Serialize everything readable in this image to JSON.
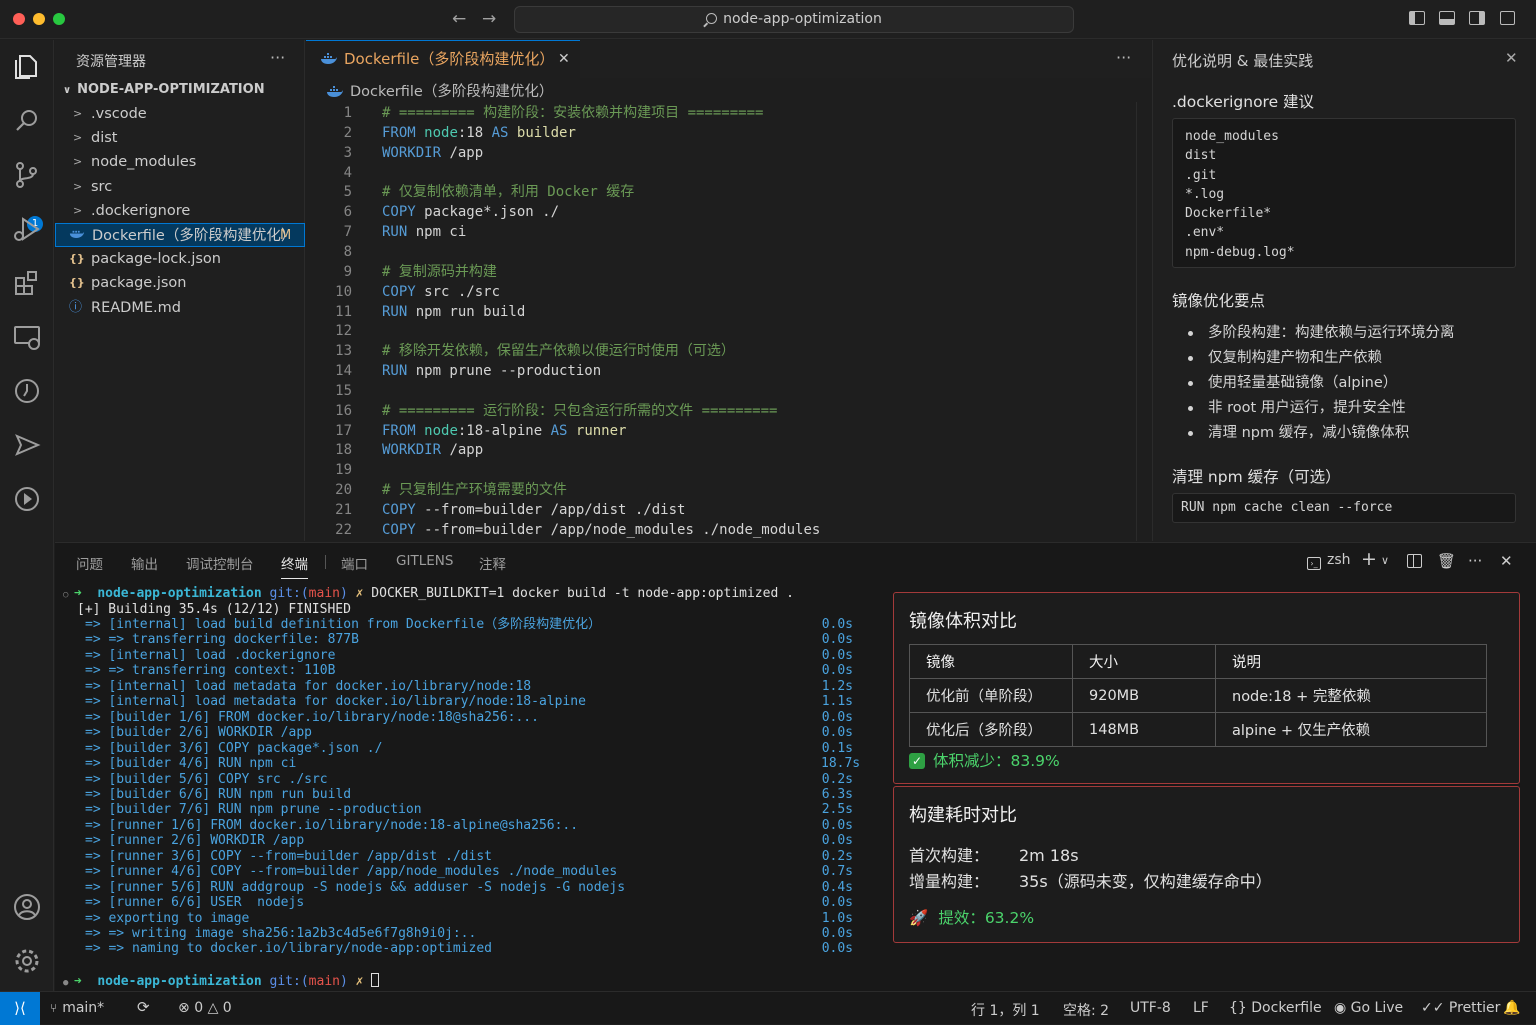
{
  "titlebar": {
    "search_text": "node-app-optimization"
  },
  "sidebar": {
    "title": "资源管理器",
    "project": "NODE-APP-OPTIMIZATION",
    "items": [
      {
        "label": ".vscode",
        "type": "folder"
      },
      {
        "label": "dist",
        "type": "folder"
      },
      {
        "label": "node_modules",
        "type": "folder"
      },
      {
        "label": "src",
        "type": "folder"
      },
      {
        "label": ".dockerignore",
        "type": "folder"
      },
      {
        "label": "Dockerfile（多阶段构建优化）",
        "type": "docker",
        "flag": "M"
      },
      {
        "label": "package-lock.json",
        "type": "json"
      },
      {
        "label": "package.json",
        "type": "json"
      },
      {
        "label": "README.md",
        "type": "info"
      }
    ],
    "scm_badge": "1"
  },
  "editor": {
    "tab_label": "Dockerfile（多阶段构建优化）",
    "breadcrumb": "Dockerfile（多阶段构建优化）",
    "lines": [
      {
        "n": "1",
        "tokens": [
          [
            "c-comment",
            "# ========= 构建阶段：安装依赖并构建项目 ========="
          ]
        ]
      },
      {
        "n": "2",
        "tokens": [
          [
            "c-kw",
            "FROM "
          ],
          [
            "c-type",
            "node"
          ],
          [
            "c-plain",
            ":18 "
          ],
          [
            "c-kw",
            "AS "
          ],
          [
            "c-alias",
            "builder"
          ]
        ]
      },
      {
        "n": "3",
        "tokens": [
          [
            "c-kw",
            "WORKDIR "
          ],
          [
            "c-plain",
            "/app"
          ]
        ]
      },
      {
        "n": "4",
        "tokens": []
      },
      {
        "n": "5",
        "tokens": [
          [
            "c-comment",
            "# 仅复制依赖清单，利用 Docker 缓存"
          ]
        ]
      },
      {
        "n": "6",
        "tokens": [
          [
            "c-kw",
            "COPY "
          ],
          [
            "c-plain",
            "package*.json ./"
          ]
        ]
      },
      {
        "n": "7",
        "tokens": [
          [
            "c-kw",
            "RUN "
          ],
          [
            "c-plain",
            "npm ci"
          ]
        ]
      },
      {
        "n": "8",
        "tokens": []
      },
      {
        "n": "9",
        "tokens": [
          [
            "c-comment",
            "# 复制源码并构建"
          ]
        ]
      },
      {
        "n": "10",
        "tokens": [
          [
            "c-kw",
            "COPY "
          ],
          [
            "c-plain",
            "src ./src"
          ]
        ]
      },
      {
        "n": "11",
        "tokens": [
          [
            "c-kw",
            "RUN "
          ],
          [
            "c-plain",
            "npm run build"
          ]
        ]
      },
      {
        "n": "12",
        "tokens": []
      },
      {
        "n": "13",
        "tokens": [
          [
            "c-comment",
            "# 移除开发依赖，保留生产依赖以便运行时使用（可选）"
          ]
        ]
      },
      {
        "n": "14",
        "tokens": [
          [
            "c-kw",
            "RUN "
          ],
          [
            "c-plain",
            "npm prune --production"
          ]
        ]
      },
      {
        "n": "15",
        "tokens": []
      },
      {
        "n": "16",
        "tokens": [
          [
            "c-comment",
            "# ========= 运行阶段：只包含运行所需的文件 ========="
          ]
        ]
      },
      {
        "n": "17",
        "tokens": [
          [
            "c-kw",
            "FROM "
          ],
          [
            "c-type",
            "node"
          ],
          [
            "c-plain",
            ":18-alpine "
          ],
          [
            "c-kw",
            "AS "
          ],
          [
            "c-alias",
            "runner"
          ]
        ]
      },
      {
        "n": "18",
        "tokens": [
          [
            "c-kw",
            "WORKDIR "
          ],
          [
            "c-plain",
            "/app"
          ]
        ]
      },
      {
        "n": "19",
        "tokens": []
      },
      {
        "n": "20",
        "tokens": [
          [
            "c-comment",
            "# 只复制生产环境需要的文件"
          ]
        ]
      },
      {
        "n": "21",
        "tokens": [
          [
            "c-kw",
            "COPY "
          ],
          [
            "c-plain",
            "--from=builder /app/dist ./dist"
          ]
        ]
      },
      {
        "n": "22",
        "tokens": [
          [
            "c-kw",
            "COPY "
          ],
          [
            "c-plain",
            "--from=builder /app/node_modules ./node_modules"
          ]
        ]
      }
    ]
  },
  "right_panel": {
    "title": "优化说明 & 最佳实践",
    "dockerignore_heading": ".dockerignore 建议",
    "dockerignore_lines": [
      "node_modules",
      "dist",
      ".git",
      "*.log",
      "Dockerfile*",
      ".env*",
      "npm-debug.log*"
    ],
    "tips_heading": "镜像优化要点",
    "tips": [
      "多阶段构建：构建依赖与运行环境分离",
      "仅复制构建产物和生产依赖",
      "使用轻量基础镜像（alpine）",
      "非 root 用户运行，提升安全性",
      "清理 npm 缓存，减小镜像体积"
    ],
    "cache_heading": "清理 npm 缓存（可选）",
    "cache_cmd": "RUN npm cache clean --force"
  },
  "panel": {
    "tabs": [
      "问题",
      "输出",
      "调试控制台",
      "终端",
      "端口",
      "GITLENS",
      "注释"
    ],
    "shell": "zsh",
    "terminal": {
      "prompt_dir": "node-app-optimization",
      "prompt_git": "git:",
      "prompt_branch_open": "(",
      "prompt_branch": "main",
      "prompt_branch_close": ")",
      "prompt_x": "✗",
      "command": "DOCKER_BUILDKIT=1 docker build -t node-app:optimized .",
      "building": "[+] Building 35.4s (12/12) FINISHED",
      "steps": [
        {
          "text": "=> [internal] load build definition from Dockerfile（多阶段构建优化）",
          "time": "0.0s"
        },
        {
          "text": "=> => transferring dockerfile: 877B",
          "time": "0.0s"
        },
        {
          "text": "=> [internal] load .dockerignore",
          "time": "0.0s"
        },
        {
          "text": "=> => transferring context: 110B",
          "time": "0.0s"
        },
        {
          "text": "=> [internal] load metadata for docker.io/library/node:18",
          "time": "1.2s"
        },
        {
          "text": "=> [internal] load metadata for docker.io/library/node:18-alpine",
          "time": "1.1s"
        },
        {
          "text": "=> [builder 1/6] FROM docker.io/library/node:18@sha256:...",
          "time": "0.0s"
        },
        {
          "text": "=> [builder 2/6] WORKDIR /app",
          "time": "0.0s"
        },
        {
          "text": "=> [builder 3/6] COPY package*.json ./",
          "time": "0.1s"
        },
        {
          "text": "=> [builder 4/6] RUN npm ci",
          "time": "18.7s"
        },
        {
          "text": "=> [builder 5/6] COPY src ./src",
          "time": "0.2s"
        },
        {
          "text": "=> [builder 6/6] RUN npm run build",
          "time": "6.3s"
        },
        {
          "text": "=> [builder 7/6] RUN npm prune --production",
          "time": "2.5s"
        },
        {
          "text": "=> [runner 1/6] FROM docker.io/library/node:18-alpine@sha256:..",
          "time": "0.0s"
        },
        {
          "text": "=> [runner 2/6] WORKDIR /app",
          "time": "0.0s"
        },
        {
          "text": "=> [runner 3/6] COPY --from=builder /app/dist ./dist",
          "time": "0.2s"
        },
        {
          "text": "=> [runner 4/6] COPY --from=builder /app/node_modules ./node_modules",
          "time": "0.7s"
        },
        {
          "text": "=> [runner 5/6] RUN addgroup -S nodejs && adduser -S nodejs -G nodejs",
          "time": "0.4s"
        },
        {
          "text": "=> [runner 6/6] USER  nodejs",
          "time": "0.0s"
        },
        {
          "text": "=> exporting to image",
          "time": "1.0s"
        },
        {
          "text": "=> => writing image sha256:1a2b3c4d5e6f7g8h9i0j:..",
          "time": "0.0s"
        },
        {
          "text": "=> => naming to docker.io/library/node-app:optimized",
          "time": "0.0s"
        }
      ]
    },
    "size_compare": {
      "title": "镜像体积对比",
      "headers": [
        "镜像",
        "大小",
        "说明"
      ],
      "rows": [
        [
          "优化前（单阶段）",
          "920MB",
          "node:18 + 完整依赖"
        ],
        [
          "优化后（多阶段）",
          "148MB",
          "alpine + 仅生产依赖"
        ]
      ],
      "result": "体积减少：83.9%"
    },
    "time_compare": {
      "title": "构建耗时对比",
      "first_label": "首次构建：",
      "first_value": "2m 18s",
      "incr_label": "增量构建：",
      "incr_value": "35s（源码未变，仅构建缓存命中）",
      "result": "提效：63.2%"
    }
  },
  "statusbar": {
    "branch": "main*",
    "errors": "0",
    "warnings": "0",
    "position": "行 1，列 1",
    "spaces": "空格: 2",
    "encoding": "UTF-8",
    "eol": "LF",
    "language": "Dockerfile",
    "golive": "Go Live",
    "prettier": "Prettier"
  },
  "colors": {
    "accent": "#0078d4",
    "comment": "#6a9955",
    "keyword": "#569cd6",
    "terminal_green": "#4bd36b"
  }
}
